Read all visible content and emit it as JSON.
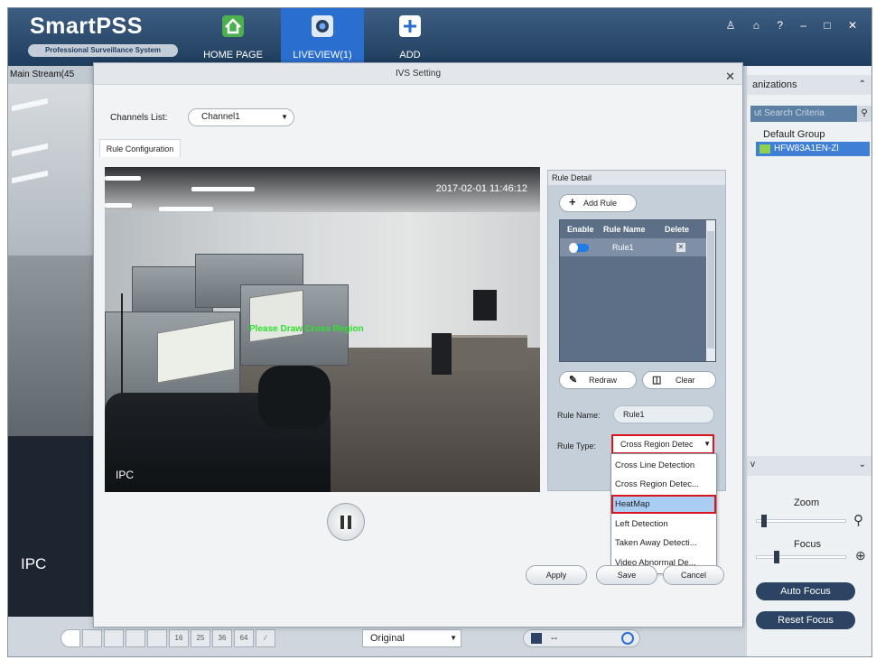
{
  "app": {
    "logo_main": "SmartPSS",
    "logo_sub": "Professional Surveillance System",
    "tabs": [
      {
        "label": "HOME PAGE"
      },
      {
        "label": "LIVEVIEW(1)"
      },
      {
        "label": "ADD"
      }
    ],
    "window_controls": "♙ ⌂ ? – □ ✕"
  },
  "left_view": {
    "header": "Main Stream(45",
    "camera_label": "IPC"
  },
  "right_panel": {
    "section_title": "anizations",
    "search_placeholder": "ut Search Criteria",
    "group": "Default Group",
    "device": "HFW83A1EN-Zl",
    "ptz_letter": "v",
    "zoom_label": "Zoom",
    "focus_label": "Focus",
    "zoom_level": 0.05,
    "focus_level": 0.2,
    "auto_focus": "Auto Focus",
    "reset_focus": "Reset Focus"
  },
  "bottom_bar": {
    "layouts": [
      "",
      "",
      "",
      "",
      "",
      "16",
      "25",
      "36",
      "64",
      "∕",
      ""
    ],
    "stream": "Original",
    "right_value": "--"
  },
  "dialog": {
    "title": "IVS Setting",
    "close": "✕",
    "channels_label": "Channels List:",
    "channel_value": "Channel1",
    "tab_rule_config": "Rule Configuration",
    "video": {
      "timestamp": "2017-02-01 11:46:12",
      "overlay": "Please Draw Cross Region",
      "camera_label": "IPC"
    },
    "rule_detail": {
      "header": "Rule Detail",
      "add_rule": "Add Rule",
      "columns": [
        "Enable",
        "Rule Name",
        "Delete"
      ],
      "rows": [
        {
          "enabled": true,
          "name": "Rule1"
        }
      ],
      "redraw": "Redraw",
      "clear": "Clear",
      "rule_name_label": "Rule Name:",
      "rule_name_value": "Rule1",
      "rule_type_label": "Rule Type:",
      "rule_type_value": "Cross Region Detec"
    },
    "rule_type_options": [
      "Cross Line Detection",
      "Cross Region Detec...",
      "HeatMap",
      "Left Detection",
      "Taken Away Detecti...",
      "Video Abnormal De..."
    ],
    "selected_option_index": 2,
    "buttons": {
      "apply": "Apply",
      "save": "Save",
      "cancel": "Cancel"
    }
  },
  "colors": {
    "highlight_border": "#d8141e",
    "toolbar_bg": "#1f3d5e",
    "active_tab": "#2a6fd0",
    "overlay_text": "#2fe22f"
  }
}
